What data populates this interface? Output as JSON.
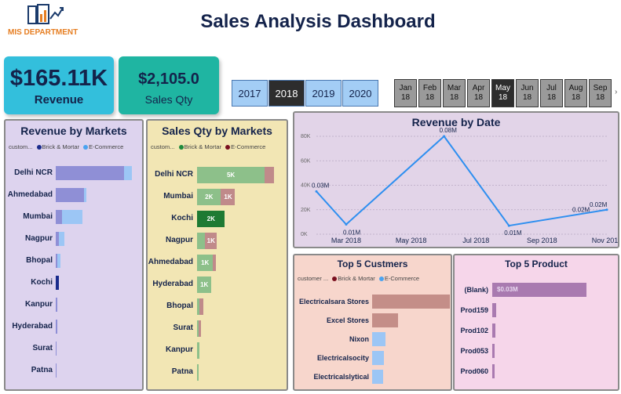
{
  "header": {
    "logo_text": "MIS DEPARTMENT",
    "title": "Sales Analysis Dashboard"
  },
  "kpis": {
    "revenue": {
      "value": "$165.11K",
      "label": "Revenue"
    },
    "sales_qty": {
      "value": "$2,105.0",
      "label": "Sales Qty"
    }
  },
  "year_slicer": {
    "items": [
      "2017",
      "2018",
      "2019",
      "2020"
    ],
    "selected": "2018"
  },
  "month_slicer": {
    "items": [
      {
        "month": "Jan",
        "year": "18"
      },
      {
        "month": "Feb",
        "year": "18"
      },
      {
        "month": "Mar",
        "year": "18"
      },
      {
        "month": "Apr",
        "year": "18"
      },
      {
        "month": "May",
        "year": "18"
      },
      {
        "month": "Jun",
        "year": "18"
      },
      {
        "month": "Jul",
        "year": "18"
      },
      {
        "month": "Aug",
        "year": "18"
      },
      {
        "month": "Sep",
        "year": "18"
      }
    ],
    "selected_index": 4,
    "next_arrow": "›"
  },
  "colors": {
    "brick_mortar_dark": "#1a2b8c",
    "ecommerce_light": "#4aa3f0",
    "qty_brick_mortar": "#1e8a3c",
    "qty_ecommerce": "#7a1020",
    "line": "#2e8ff0"
  },
  "revenue_by_markets": {
    "title": "Revenue by Markets",
    "legend": {
      "label": "custom...",
      "series": [
        "Brick & Mortar",
        "E-Commerce"
      ]
    },
    "rows": [
      {
        "market": "Delhi NCR",
        "brick": 85,
        "ecom": 10
      },
      {
        "market": "Ahmedabad",
        "brick": 35,
        "ecom": 3
      },
      {
        "market": "Mumbai",
        "brick": 8,
        "ecom": 25
      },
      {
        "market": "Nagpur",
        "brick": 4,
        "ecom": 7
      },
      {
        "market": "Bhopal",
        "brick": 1.5,
        "ecom": 4.5
      },
      {
        "market": "Kochi",
        "brick": 4,
        "ecom": 0
      },
      {
        "market": "Kanpur",
        "brick": 1.5,
        "ecom": 0
      },
      {
        "market": "Hyderabad",
        "brick": 1.5,
        "ecom": 0
      },
      {
        "market": "Surat",
        "brick": 1,
        "ecom": 0
      },
      {
        "market": "Patna",
        "brick": 0.5,
        "ecom": 0
      }
    ]
  },
  "sales_qty_by_markets": {
    "title": "Sales Qty by Markets",
    "legend": {
      "label": "custom...",
      "series": [
        "Brick & Mortar",
        "E-Commerce"
      ]
    },
    "rows": [
      {
        "market": "Delhi NCR",
        "brick": 85,
        "ecom": 12,
        "label": "5K"
      },
      {
        "market": "Mumbai",
        "brick": 30,
        "ecom": 18,
        "label": "2K",
        "label2": "1K"
      },
      {
        "market": "Kochi",
        "brick": 35,
        "ecom": 0,
        "label": "2K",
        "highlight": true
      },
      {
        "market": "Nagpur",
        "brick": 10,
        "ecom": 15,
        "label": "",
        "label2": "1K"
      },
      {
        "market": "Ahmedabad",
        "brick": 20,
        "ecom": 4,
        "label": "1K"
      },
      {
        "market": "Hyderabad",
        "brick": 18,
        "ecom": 0,
        "label": "1K"
      },
      {
        "market": "Bhopal",
        "brick": 3,
        "ecom": 5,
        "label": ""
      },
      {
        "market": "Surat",
        "brick": 2,
        "ecom": 3,
        "label": ""
      },
      {
        "market": "Kanpur",
        "brick": 3,
        "ecom": 0,
        "label": ""
      },
      {
        "market": "Patna",
        "brick": 1.5,
        "ecom": 0,
        "label": ""
      }
    ]
  },
  "chart_data": [
    {
      "type": "line",
      "title": "Revenue by Date",
      "x": [
        "2018-02-01",
        "2018-03-01",
        "2018-06-01",
        "2018-08-01",
        "2018-11-01"
      ],
      "y": [
        35000,
        8000,
        80000,
        7000,
        20000
      ],
      "point_labels": [
        "0.03M",
        "0.01M",
        "0.08M",
        "0.01M",
        "0.02M"
      ],
      "extra_labels": [
        {
          "x": "2018-10-01",
          "label": "0.02M"
        }
      ],
      "ylim": [
        0,
        80000
      ],
      "y_ticks": [
        "0K",
        "20K",
        "40K",
        "60K",
        "80K"
      ],
      "x_ticks": [
        "Mar 2018",
        "May 2018",
        "Jul 2018",
        "Sep 2018",
        "Nov 2018"
      ],
      "grid": true
    },
    {
      "type": "bar",
      "title": "Top 5 Custmers",
      "legend": {
        "label": "customer ...",
        "series": [
          "Brick & Mortar",
          "E-Commerce"
        ]
      },
      "categories": [
        "Electricalsara Stores",
        "Excel Stores",
        "Nixon",
        "Electricalsocity",
        "Electricalslytical"
      ],
      "values": [
        100,
        33,
        17,
        15,
        14
      ],
      "series_type": [
        "brick",
        "brick",
        "ecom",
        "ecom",
        "ecom"
      ]
    },
    {
      "type": "bar",
      "title": "Top 5 Product",
      "categories": [
        "(Blank)",
        "Prod159",
        "Prod102",
        "Prod053",
        "Prod060"
      ],
      "values": [
        100,
        4,
        3,
        2.5,
        2
      ],
      "data_labels": [
        "$0.03M",
        "",
        "",
        "",
        ""
      ]
    }
  ]
}
